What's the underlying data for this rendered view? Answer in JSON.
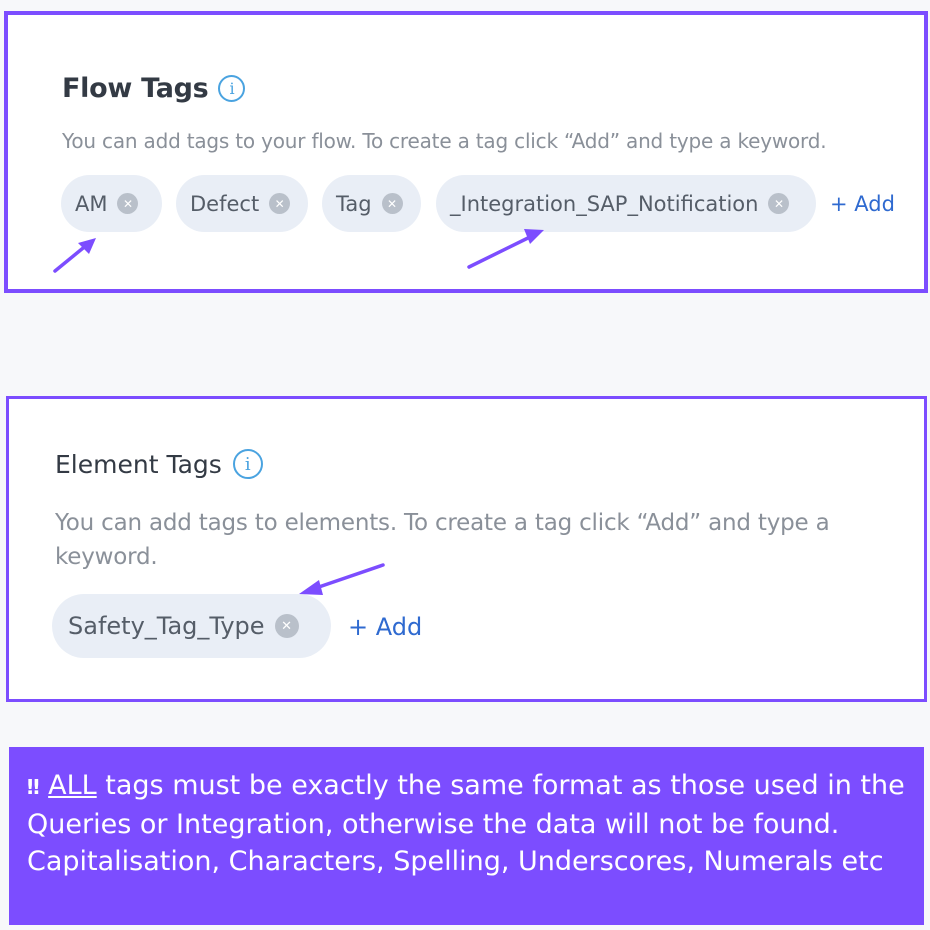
{
  "flow_tags": {
    "title": "Flow Tags",
    "info_glyph": "i",
    "description": "You can add tags to your flow. To create a tag click “Add” and type a keyword.",
    "tags": [
      "AM",
      "Defect",
      "Tag",
      "_Integration_SAP_Notification"
    ],
    "remove_glyph": "✕",
    "add_label": "+ Add"
  },
  "element_tags": {
    "title": "Element Tags",
    "info_glyph": "i",
    "description": "You can add tags to elements. To create a tag click “Add” and type a keyword.",
    "tags": [
      "Safety_Tag_Type"
    ],
    "remove_glyph": "✕",
    "add_label": "+ Add"
  },
  "warning": {
    "bang": "‼",
    "emphasis": "ALL",
    "text": " tags must be exactly the same format as those used in the Queries or Integration, otherwise the data will not be found. Capitalisation, Characters, Spelling, Underscores, Numerals etc"
  },
  "colors": {
    "accent": "#7c4dff",
    "chip_bg": "#e9eef6",
    "link": "#2f6ad0",
    "info": "#4aa3e0"
  }
}
